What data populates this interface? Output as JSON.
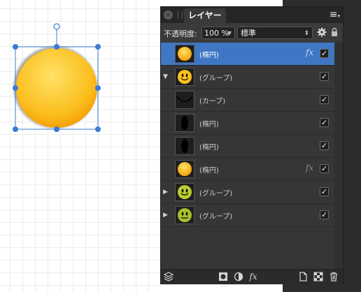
{
  "canvas": {
    "element": "ellipse-smiley-face",
    "fill_gradient": [
      "#ffe266",
      "#f5a300"
    ]
  },
  "panel": {
    "close_symbol": "×",
    "tab_label": "レイヤー",
    "menu_symbol": "≡",
    "opacity_label": "不透明度:",
    "opacity_value": "100 %",
    "blend_mode": "標準",
    "accent_color": "#3f77c4"
  },
  "layers": [
    {
      "name": "(楕円)",
      "thumb": "yellow-circle-icon",
      "expander": "",
      "fx": "fx",
      "checked": "✓",
      "selected": true
    },
    {
      "name": "(グループ)",
      "thumb": "smiley-yellow-icon",
      "expander": "▼",
      "fx": "",
      "checked": "✓",
      "selected": false
    },
    {
      "name": "(カーブ)",
      "thumb": "curve-icon",
      "expander": "",
      "fx": "",
      "checked": "✓",
      "selected": false
    },
    {
      "name": "(楕円)",
      "thumb": "black-ellipse-icon",
      "expander": "",
      "fx": "",
      "checked": "✓",
      "selected": false
    },
    {
      "name": "(楕円)",
      "thumb": "black-ellipse-icon",
      "expander": "",
      "fx": "",
      "checked": "✓",
      "selected": false
    },
    {
      "name": "(楕円)",
      "thumb": "yellow-circle-icon",
      "expander": "",
      "fx": "fx",
      "checked": "✓",
      "selected": false
    },
    {
      "name": "(グループ)",
      "thumb": "smiley-green-icon",
      "expander": "▶",
      "fx": "",
      "checked": "✓",
      "selected": false
    },
    {
      "name": "(グループ)",
      "thumb": "neutral-green-icon",
      "expander": "▶",
      "fx": "",
      "checked": "✓",
      "selected": false
    }
  ],
  "bottom_bar": {
    "fx_label": "fx"
  }
}
